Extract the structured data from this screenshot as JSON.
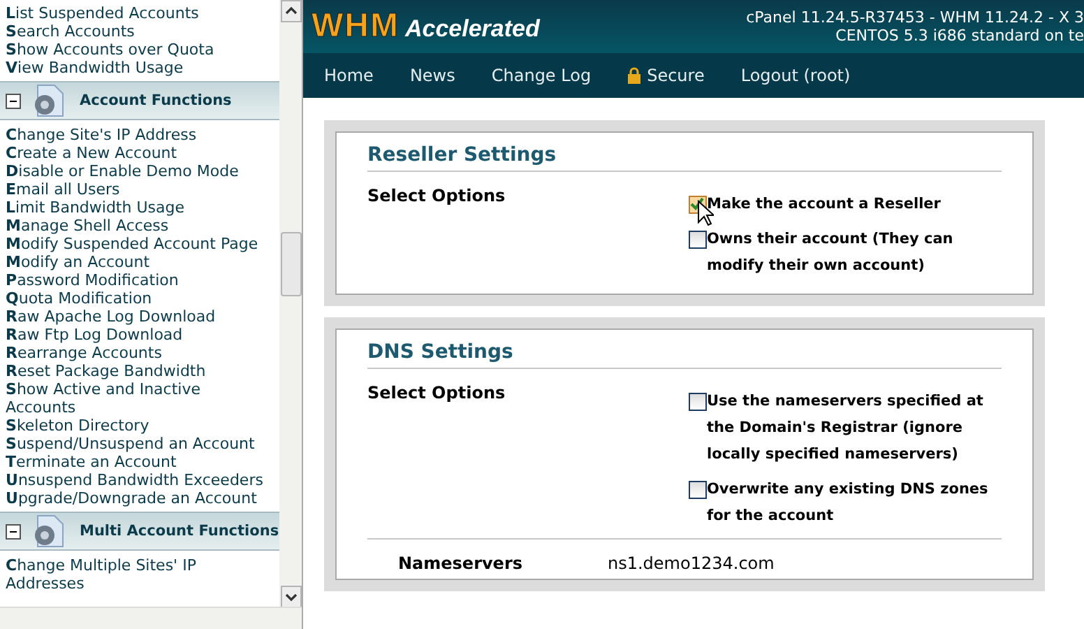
{
  "sidebar": {
    "groups": [
      {
        "links": [
          "**L**ist Suspended Accounts",
          "**S**earch Accounts",
          "**S**how Accounts over Quota",
          "**V**iew Bandwidth Usage"
        ]
      },
      {
        "title": "Account Functions",
        "expanded": true,
        "links": [
          "**C**hange Site's IP Address",
          "**C**reate a New Account",
          "**D**isable or Enable Demo Mode",
          "**E**mail all Users",
          "**L**imit Bandwidth Usage",
          "**M**anage Shell Access",
          "**M**odify Suspended Account Page",
          "**M**odify an Account",
          "**P**assword Modification",
          "**Q**uota Modification",
          "**R**aw Apache Log Download",
          "**R**aw Ftp Log Download",
          "**R**earrange Accounts",
          "**R**eset Package Bandwidth",
          "**S**how Active and Inactive Accounts",
          "**S**keleton Directory",
          "**S**uspend/Unsuspend an Account",
          "**T**erminate an Account",
          "**U**nsuspend Bandwidth Exceeders",
          "**U**pgrade/Downgrade an Account"
        ]
      },
      {
        "title": "Multi Account Functions",
        "expanded": true,
        "links": [
          "**C**hange Multiple Sites' IP Addresses"
        ]
      }
    ]
  },
  "header": {
    "logo_main": "WHM",
    "logo_sub": "Accelerated",
    "version_lines": [
      "cPanel 11.24.5-R37453 - WHM 11.24.2 - X 3",
      "CENTOS 5.3 i686 standard on te"
    ]
  },
  "nav": [
    {
      "label": "Home",
      "kind": "link"
    },
    {
      "label": "News",
      "kind": "link"
    },
    {
      "label": "Change Log",
      "kind": "link"
    },
    {
      "label": "Secure",
      "kind": "lock"
    },
    {
      "label": "Logout (root)",
      "kind": "link"
    }
  ],
  "sections": [
    {
      "title": "Reseller Settings",
      "options_label": "Select Options",
      "options": [
        {
          "label": "Make the account a Reseller",
          "checked": true
        },
        {
          "label": "Owns their account (They can modify their own account)",
          "checked": false
        }
      ]
    },
    {
      "title": "DNS Settings",
      "options_label": "Select Options",
      "options": [
        {
          "label": "Use the nameservers specified at the Domain's Registrar (ignore locally specified nameservers)",
          "checked": false
        },
        {
          "label": "Overwrite any existing DNS zones for the account",
          "checked": false
        }
      ],
      "fields": [
        {
          "label": "Nameservers",
          "value": "ns1.demo1234.com"
        }
      ]
    }
  ]
}
